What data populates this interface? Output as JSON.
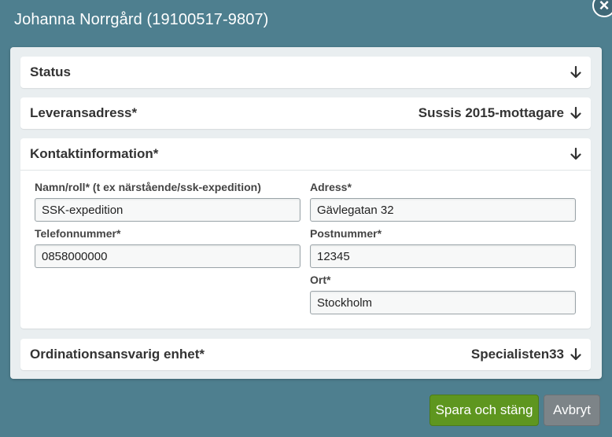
{
  "dialog": {
    "title": "Johanna Norrgård (19100517-9807)",
    "close_symbol": "×"
  },
  "sections": {
    "status": {
      "title": "Status",
      "value": ""
    },
    "delivery": {
      "title": "Leveransadress*",
      "value": "Sussis 2015-mottagare"
    },
    "contact": {
      "title": "Kontaktinformation*",
      "fields": {
        "name_role": {
          "label": "Namn/roll* (t ex närstående/ssk-expedition)",
          "value": "SSK-expedition"
        },
        "phone": {
          "label": "Telefonnummer*",
          "value": "0858000000"
        },
        "address": {
          "label": "Adress*",
          "value": "Gävlegatan 32"
        },
        "postal_code": {
          "label": "Postnummer*",
          "value": "12345"
        },
        "city": {
          "label": "Ort*",
          "value": "Stockholm"
        }
      }
    },
    "ordination": {
      "title": "Ordinationsansvarig enhet*",
      "value": "Specialisten33"
    }
  },
  "footer": {
    "save_label": "Spara och stäng",
    "cancel_label": "Avbryt"
  },
  "icons": {
    "expand": "arrow-down-icon",
    "close": "close-icon"
  },
  "colors": {
    "backdrop": "#4e7f8f",
    "save_button": "#5e961f",
    "cancel_button": "#7d8488"
  }
}
